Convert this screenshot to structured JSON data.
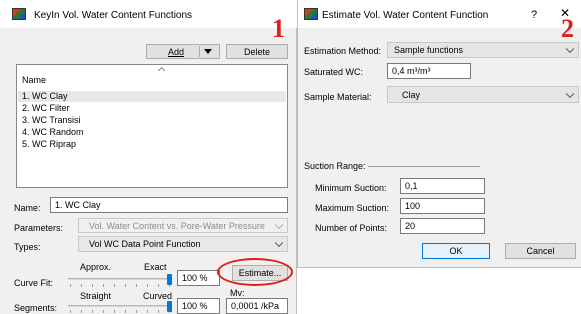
{
  "left": {
    "title": "KeyIn Vol. Water Content Functions",
    "add_label": "Add",
    "delete_label": "Delete",
    "list_header": "Name",
    "items": [
      "1. WC Clay",
      "2. WC Filter",
      "3. WC Transisi",
      "4. WC Random",
      "5. WC Riprap"
    ],
    "selected_index": 0,
    "name_label": "Name:",
    "name_value": "1. WC Clay",
    "parameters_label": "Parameters:",
    "parameters_value": "Vol. Water Content vs. Pore-Water Pressure",
    "types_label": "Types:",
    "types_value": "Vol WC Data Point Function",
    "curve_fit_label": "Curve Fit:",
    "approx_label": "Approx.",
    "exact_label": "Exact",
    "curve_fit_value": "100 %",
    "curve_fit_percent": 100,
    "estimate_label": "Estimate...",
    "segments_label": "Segments:",
    "straight_label": "Straight",
    "curved_label": "Curved",
    "segments_value": "100 %",
    "segments_percent": 100,
    "mv_label": "Mv:",
    "mv_value": "0,0001 /kPa"
  },
  "right": {
    "title": "Estimate Vol. Water Content Function",
    "help_glyph": "?",
    "estimation_method_label": "Estimation Method:",
    "estimation_method_value": "Sample functions",
    "saturated_wc_label": "Saturated WC:",
    "saturated_wc_value": "0,4 m³/m³",
    "sample_material_label": "Sample Material:",
    "sample_material_value": "Clay",
    "suction_range_label": "Suction Range:",
    "min_suction_label": "Minimum Suction:",
    "min_suction_value": "0,1",
    "max_suction_label": "Maximum Suction:",
    "max_suction_value": "100",
    "num_points_label": "Number of Points:",
    "num_points_value": "20",
    "ok_label": "OK",
    "cancel_label": "Cancel"
  },
  "annotations": {
    "marker_1": "1",
    "marker_2": "2",
    "highlight_color": "#e01d1d"
  },
  "colors": {
    "accent": "#0078d7",
    "selection": "#e8e8e8",
    "window_bg": "#f0f0f0"
  },
  "icons": {
    "app": "geostudio-app-icon",
    "close": "close-icon",
    "dropdown": "chevron-down-icon"
  }
}
